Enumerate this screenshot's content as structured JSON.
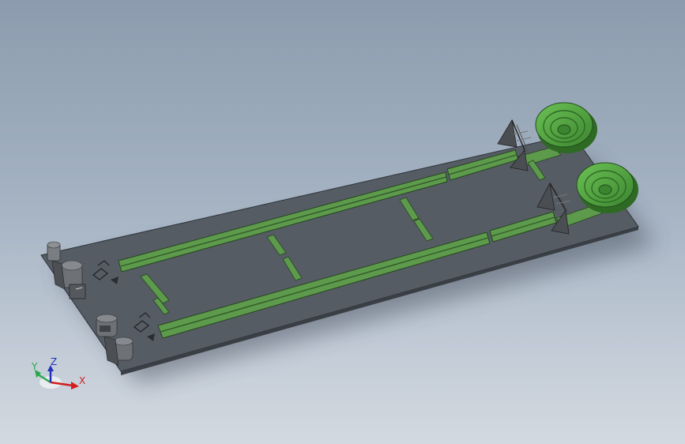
{
  "viewport": {
    "background_top": "#8c9cae",
    "background_bottom": "#d3d9e0"
  },
  "model": {
    "plate_color": "#555c64",
    "rail_color": "#5d9a4c",
    "rail_dark": "#2f5a26",
    "roll_color": "#4f9a3f",
    "roll_dark": "#2e6a24",
    "hardware_color": "#6e7276"
  },
  "triad": {
    "x_label": "X",
    "y_label": "Y",
    "z_label": "Z",
    "x_color": "#d21e1e",
    "y_color": "#2aa84a",
    "z_color": "#2233bb"
  }
}
